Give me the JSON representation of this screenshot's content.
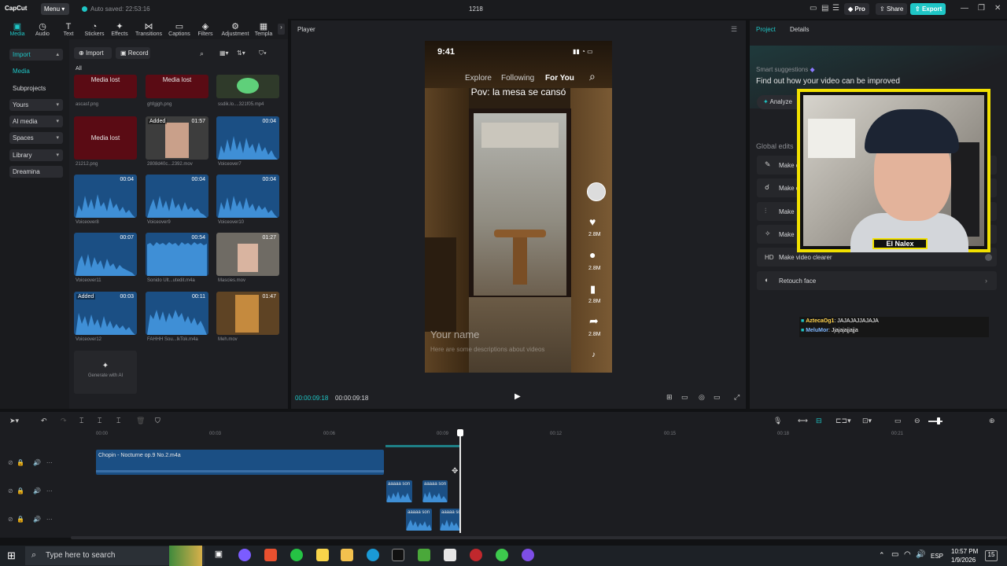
{
  "titlebar": {
    "logo": "CapCut",
    "menu": "Menu",
    "autosaved": "Auto saved: 22:53:16",
    "project_name": "1218",
    "pro": "Pro",
    "share": "Share",
    "export": "Export"
  },
  "toolbar": {
    "tools": [
      "Media",
      "Audio",
      "Text",
      "Stickers",
      "Effects",
      "Transitions",
      "Captions",
      "Filters",
      "Adjustment",
      "Templa"
    ]
  },
  "sidebar": {
    "items": [
      "Import",
      "Media",
      "Subprojects",
      "Yours",
      "AI media",
      "Spaces",
      "Library",
      "Dreamina"
    ]
  },
  "media": {
    "import": "Import",
    "record": "Record",
    "filter_all": "All",
    "items": [
      {
        "name": "ascasf.png",
        "state": "Media lost"
      },
      {
        "name": "ghfgjgh.png",
        "state": "Media lost"
      },
      {
        "name": "ssdik.lo....321f05.mp4",
        "state": ""
      },
      {
        "name": "21212.png",
        "state": "Media lost"
      },
      {
        "name": "2808d40c...2392.mov",
        "duration": "01:57",
        "badge": "Added"
      },
      {
        "name": "Voiceover7",
        "duration": "00:04"
      },
      {
        "name": "Voiceover8",
        "duration": "00:04"
      },
      {
        "name": "Voiceover9",
        "duration": "00:04"
      },
      {
        "name": "Voiceover10",
        "duration": "00:04"
      },
      {
        "name": "Voiceover11",
        "duration": "00:07"
      },
      {
        "name": "Sonido Ult...utedit.m4a",
        "duration": "00:54"
      },
      {
        "name": "Mascies.mov",
        "duration": "01:27"
      },
      {
        "name": "Voiceover12",
        "duration": "00:03",
        "badge": "Added"
      },
      {
        "name": "FAHHH Sou...lkTok.m4a",
        "duration": "00:11"
      },
      {
        "name": "Meh.mov",
        "duration": "01:47"
      }
    ],
    "generate": "Generate with AI"
  },
  "player": {
    "label": "Player",
    "status_time": "9:41",
    "tabs": [
      "Explore",
      "Following",
      "For You"
    ],
    "overlay_text": "Pov: la mesa se cansó",
    "likes": "2.8M",
    "comments": "2.8M",
    "saves": "2.8M",
    "shares": "2.8M",
    "name_placeholder": "Your name",
    "desc_placeholder": "Here are some descriptions about videos",
    "current_time": "00:00:09:18",
    "total_time": "00:00:09:18"
  },
  "right_panel": {
    "tabs": [
      "Project",
      "Details"
    ],
    "smart_title": "Smart suggestions",
    "smart_desc": "Find out how your video can be improved",
    "analyze": "Analyze",
    "global_title": "Global edits",
    "rows": [
      "Make c",
      "Make c",
      "Make",
      "Make",
      "Make video clearer",
      "Retouch face"
    ]
  },
  "webcam": {
    "name": "El Nalex"
  },
  "chat": [
    {
      "user": "AztecaOg1",
      "msg": ": JAJAJAJJAJAJA"
    },
    {
      "user": "MeluMor",
      "msg": ": Jjajajajjajja"
    }
  ],
  "timeline": {
    "ticks": [
      "00:00",
      "00:03",
      "00:06",
      "00:09",
      "00:12",
      "00:15",
      "00:18",
      "00:21"
    ],
    "audio_clip": "Chopin - Nocturne op.9 No.2.m4a",
    "small_clip": "aaaaa son"
  },
  "taskbar": {
    "search": "Type here to search",
    "lang": "ESP",
    "time": "10:57 PM",
    "date": "1/9/2026",
    "notif": "15"
  },
  "colors": {
    "accent": "#1fc6c6",
    "lost": "#5a0b14",
    "audio": "#1b4f84",
    "webcam_border": "#f2e100"
  }
}
